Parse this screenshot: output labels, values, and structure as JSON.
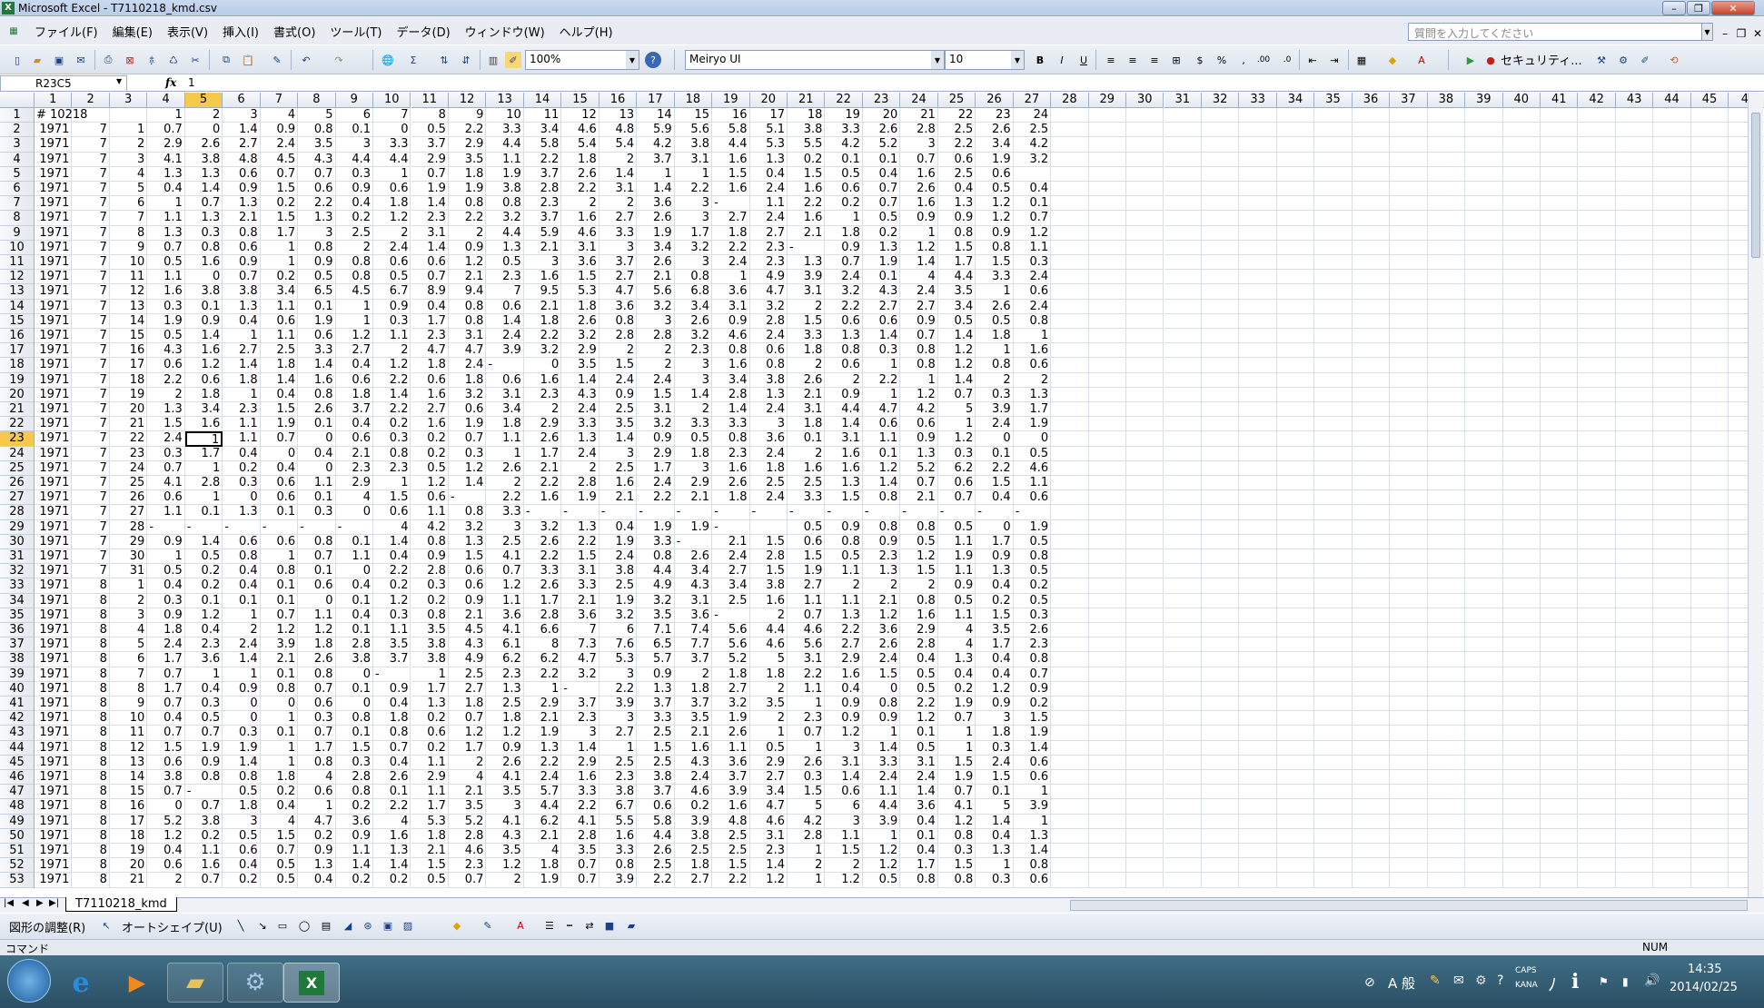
{
  "window": {
    "title": "Microsoft Excel - T7110218_kmd.csv"
  },
  "menu": [
    "ファイル(F)",
    "編集(E)",
    "表示(V)",
    "挿入(I)",
    "書式(O)",
    "ツール(T)",
    "データ(D)",
    "ウィンドウ(W)",
    "ヘルプ(H)"
  ],
  "ask_placeholder": "質問を入力してください",
  "toolbar": {
    "zoom": "100%",
    "font": "Meiryo UI",
    "size": "10",
    "security": "セキュリティ..."
  },
  "formula": {
    "namebox": "R23C5",
    "fx": "fx",
    "value": "1"
  },
  "active": {
    "row": 23,
    "col": 5
  },
  "col_headers": [
    "1",
    "2",
    "3",
    "4",
    "5",
    "6",
    "7",
    "8",
    "9",
    "10",
    "11",
    "12",
    "13",
    "14",
    "15",
    "16",
    "17",
    "18",
    "19",
    "20",
    "21",
    "22",
    "23",
    "24",
    "25",
    "26",
    "27",
    "28",
    "29",
    "30",
    "31",
    "32",
    "33",
    "34",
    "35",
    "36",
    "37",
    "38",
    "39",
    "40",
    "41",
    "42",
    "43",
    "44",
    "45",
    "4("
  ],
  "rows": [
    [
      "# 10218",
      "",
      "",
      "1",
      "2",
      "3",
      "4",
      "5",
      "6",
      "7",
      "8",
      "9",
      "10",
      "11",
      "12",
      "13",
      "14",
      "15",
      "16",
      "17",
      "18",
      "19",
      "20",
      "21",
      "22",
      "23",
      "24"
    ],
    [
      "1971",
      "7",
      "1",
      "0.7",
      "0",
      "1.4",
      "0.9",
      "0.8",
      "0.1",
      "0",
      "0.5",
      "2.2",
      "3.3",
      "3.4",
      "4.6",
      "4.8",
      "5.9",
      "5.6",
      "5.8",
      "5.1",
      "3.8",
      "3.3",
      "2.6",
      "2.8",
      "2.5",
      "2.6",
      "2.5"
    ],
    [
      "1971",
      "7",
      "2",
      "2.9",
      "2.6",
      "2.7",
      "2.4",
      "3.5",
      "3",
      "3.3",
      "3.7",
      "2.9",
      "4.4",
      "5.8",
      "5.4",
      "5.4",
      "4.2",
      "3.8",
      "4.4",
      "5.3",
      "5.5",
      "4.2",
      "5.2",
      "3",
      "2.2",
      "3.4",
      "4.2"
    ],
    [
      "1971",
      "7",
      "3",
      "4.1",
      "3.8",
      "4.8",
      "4.5",
      "4.3",
      "4.4",
      "4.4",
      "2.9",
      "3.5",
      "1.1",
      "2.2",
      "1.8",
      "2",
      "3.7",
      "3.1",
      "1.6",
      "1.3",
      "0.2",
      "0.1",
      "0.1",
      "0.7",
      "0.6",
      "1.9",
      "3.2"
    ],
    [
      "1971",
      "7",
      "4",
      "1.3",
      "1.3",
      "0.6",
      "0.7",
      "0.7",
      "0.3",
      "1",
      "0.7",
      "1.8",
      "1.9",
      "3.7",
      "2.6",
      "1.4",
      "1",
      "1",
      "1.5",
      "0.4",
      "1.5",
      "0.5",
      "0.4",
      "1.6",
      "2.5",
      "0.6",
      ""
    ],
    [
      "1971",
      "7",
      "5",
      "0.4",
      "1.4",
      "0.9",
      "1.5",
      "0.6",
      "0.9",
      "0.6",
      "1.9",
      "1.9",
      "3.8",
      "2.8",
      "2.2",
      "3.1",
      "1.4",
      "2.2",
      "1.6",
      "2.4",
      "1.6",
      "0.6",
      "0.7",
      "2.6",
      "0.4",
      "0.5",
      "0.4"
    ],
    [
      "1971",
      "7",
      "6",
      "1",
      "0.7",
      "1.3",
      "0.2",
      "2.2",
      "0.4",
      "1.8",
      "1.4",
      "0.8",
      "0.8",
      "2.3",
      "2",
      "2",
      "3.6",
      "3",
      "-",
      "1.1",
      "2.2",
      "0.2",
      "0.7",
      "1.6",
      "1.3",
      "1.2",
      "0.1"
    ],
    [
      "1971",
      "7",
      "7",
      "1.1",
      "1.3",
      "2.1",
      "1.5",
      "1.3",
      "0.2",
      "1.2",
      "2.3",
      "2.2",
      "3.2",
      "3.7",
      "1.6",
      "2.7",
      "2.6",
      "3",
      "2.7",
      "2.4",
      "1.6",
      "1",
      "0.5",
      "0.9",
      "0.9",
      "1.2",
      "0.7"
    ],
    [
      "1971",
      "7",
      "8",
      "1.3",
      "0.3",
      "0.8",
      "1.7",
      "3",
      "2.5",
      "2",
      "3.1",
      "2",
      "4.4",
      "5.9",
      "4.6",
      "3.3",
      "1.9",
      "1.7",
      "1.8",
      "2.7",
      "2.1",
      "1.8",
      "0.2",
      "1",
      "0.8",
      "0.9",
      "1.2"
    ],
    [
      "1971",
      "7",
      "9",
      "0.7",
      "0.8",
      "0.6",
      "1",
      "0.8",
      "2",
      "2.4",
      "1.4",
      "0.9",
      "1.3",
      "2.1",
      "3.1",
      "3",
      "3.4",
      "3.2",
      "2.2",
      "2.3",
      "-",
      "0.9",
      "1.3",
      "1.2",
      "1.5",
      "0.8",
      "1.1"
    ],
    [
      "1971",
      "7",
      "10",
      "0.5",
      "1.6",
      "0.9",
      "1",
      "0.9",
      "0.8",
      "0.6",
      "0.6",
      "1.2",
      "0.5",
      "3",
      "3.6",
      "3.7",
      "2.6",
      "3",
      "2.4",
      "2.3",
      "1.3",
      "0.7",
      "1.9",
      "1.4",
      "1.7",
      "1.5",
      "0.3"
    ],
    [
      "1971",
      "7",
      "11",
      "1.1",
      "0",
      "0.7",
      "0.2",
      "0.5",
      "0.8",
      "0.5",
      "0.7",
      "2.1",
      "2.3",
      "1.6",
      "1.5",
      "2.7",
      "2.1",
      "0.8",
      "1",
      "4.9",
      "3.9",
      "2.4",
      "0.1",
      "4",
      "4.4",
      "3.3",
      "2.4"
    ],
    [
      "1971",
      "7",
      "12",
      "1.6",
      "3.8",
      "3.8",
      "3.4",
      "6.5",
      "4.5",
      "6.7",
      "8.9",
      "9.4",
      "7",
      "9.5",
      "5.3",
      "4.7",
      "5.6",
      "6.8",
      "3.6",
      "4.7",
      "3.1",
      "3.2",
      "4.3",
      "2.4",
      "3.5",
      "1",
      "0.6"
    ],
    [
      "1971",
      "7",
      "13",
      "0.3",
      "0.1",
      "1.3",
      "1.1",
      "0.1",
      "1",
      "0.9",
      "0.4",
      "0.8",
      "0.6",
      "2.1",
      "1.8",
      "3.6",
      "3.2",
      "3.4",
      "3.1",
      "3.2",
      "2",
      "2.2",
      "2.7",
      "2.7",
      "3.4",
      "2.6",
      "2.4"
    ],
    [
      "1971",
      "7",
      "14",
      "1.9",
      "0.9",
      "0.4",
      "0.6",
      "1.9",
      "1",
      "0.3",
      "1.7",
      "0.8",
      "1.4",
      "1.8",
      "2.6",
      "0.8",
      "3",
      "2.6",
      "0.9",
      "2.8",
      "1.5",
      "0.6",
      "0.6",
      "0.9",
      "0.5",
      "0.5",
      "0.8"
    ],
    [
      "1971",
      "7",
      "15",
      "0.5",
      "1.4",
      "1",
      "1.1",
      "0.6",
      "1.2",
      "1.1",
      "2.3",
      "3.1",
      "2.4",
      "2.2",
      "3.2",
      "2.8",
      "2.8",
      "3.2",
      "4.6",
      "2.4",
      "3.3",
      "1.3",
      "1.4",
      "0.7",
      "1.4",
      "1.8",
      "1"
    ],
    [
      "1971",
      "7",
      "16",
      "4.3",
      "1.6",
      "2.7",
      "2.5",
      "3.3",
      "2.7",
      "2",
      "4.7",
      "4.7",
      "3.9",
      "3.2",
      "2.9",
      "2",
      "2",
      "2.3",
      "0.8",
      "0.6",
      "1.8",
      "0.8",
      "0.3",
      "0.8",
      "1.2",
      "1",
      "1.6"
    ],
    [
      "1971",
      "7",
      "17",
      "0.6",
      "1.2",
      "1.4",
      "1.8",
      "1.4",
      "0.4",
      "1.2",
      "1.8",
      "2.4",
      "-",
      "0",
      "3.5",
      "1.5",
      "2",
      "3",
      "1.6",
      "0.8",
      "2",
      "0.6",
      "1",
      "0.8",
      "1.2",
      "0.8",
      "0.6"
    ],
    [
      "1971",
      "7",
      "18",
      "2.2",
      "0.6",
      "1.8",
      "1.4",
      "1.6",
      "0.6",
      "2.2",
      "0.6",
      "1.8",
      "0.6",
      "1.6",
      "1.4",
      "2.4",
      "2.4",
      "3",
      "3.4",
      "3.8",
      "2.6",
      "2",
      "2.2",
      "1",
      "1.4",
      "2",
      "2"
    ],
    [
      "1971",
      "7",
      "19",
      "2",
      "1.8",
      "1",
      "0.4",
      "0.8",
      "1.8",
      "1.4",
      "1.6",
      "3.2",
      "3.1",
      "2.3",
      "4.3",
      "0.9",
      "1.5",
      "1.4",
      "2.8",
      "1.3",
      "2.1",
      "0.9",
      "1",
      "1.2",
      "0.7",
      "0.3",
      "1.3"
    ],
    [
      "1971",
      "7",
      "20",
      "1.3",
      "3.4",
      "2.3",
      "1.5",
      "2.6",
      "3.7",
      "2.2",
      "2.7",
      "0.6",
      "3.4",
      "2",
      "2.4",
      "2.5",
      "3.1",
      "2",
      "1.4",
      "2.4",
      "3.1",
      "4.4",
      "4.7",
      "4.2",
      "5",
      "3.9",
      "1.7"
    ],
    [
      "1971",
      "7",
      "21",
      "1.5",
      "1.6",
      "1.1",
      "1.9",
      "0.1",
      "0.4",
      "0.2",
      "1.6",
      "1.9",
      "1.8",
      "2.9",
      "3.3",
      "3.5",
      "3.2",
      "3.3",
      "3.3",
      "3",
      "1.8",
      "1.4",
      "0.6",
      "0.6",
      "1",
      "2.4",
      "1.9"
    ],
    [
      "1971",
      "7",
      "22",
      "2.4",
      "1",
      "1.1",
      "0.7",
      "0",
      "0.6",
      "0.3",
      "0.2",
      "0.7",
      "1.1",
      "2.6",
      "1.3",
      "1.4",
      "0.9",
      "0.5",
      "0.8",
      "3.6",
      "0.1",
      "3.1",
      "1.1",
      "0.9",
      "1.2",
      "0",
      "0"
    ],
    [
      "1971",
      "7",
      "23",
      "0.3",
      "1.7",
      "0.4",
      "0",
      "0.4",
      "2.1",
      "0.8",
      "0.2",
      "0.3",
      "1",
      "1.7",
      "2.4",
      "3",
      "2.9",
      "1.8",
      "2.3",
      "2.4",
      "2",
      "1.6",
      "0.1",
      "1.3",
      "0.3",
      "0.1",
      "0.5"
    ],
    [
      "1971",
      "7",
      "24",
      "0.7",
      "1",
      "0.2",
      "0.4",
      "0",
      "2.3",
      "2.3",
      "0.5",
      "1.2",
      "2.6",
      "2.1",
      "2",
      "2.5",
      "1.7",
      "3",
      "1.6",
      "1.8",
      "1.6",
      "1.6",
      "1.2",
      "5.2",
      "6.2",
      "2.2",
      "4.6"
    ],
    [
      "1971",
      "7",
      "25",
      "4.1",
      "2.8",
      "0.3",
      "0.6",
      "1.1",
      "2.9",
      "1",
      "1.2",
      "1.4",
      "2",
      "2.2",
      "2.8",
      "1.6",
      "2.4",
      "2.9",
      "2.6",
      "2.5",
      "2.5",
      "1.3",
      "1.4",
      "0.7",
      "0.6",
      "1.5",
      "1.1"
    ],
    [
      "1971",
      "7",
      "26",
      "0.6",
      "1",
      "0",
      "0.6",
      "0.1",
      "4",
      "1.5",
      "0.6",
      "-",
      "2.2",
      "1.6",
      "1.9",
      "2.1",
      "2.2",
      "2.1",
      "1.8",
      "2.4",
      "3.3",
      "1.5",
      "0.8",
      "2.1",
      "0.7",
      "0.4",
      "0.6"
    ],
    [
      "1971",
      "7",
      "27",
      "1.1",
      "0.1",
      "1.3",
      "0.1",
      "0.3",
      "0",
      "0.6",
      "1.1",
      "0.8",
      "3.3",
      "-",
      "-",
      "-",
      "-",
      "-",
      "-",
      "-",
      "-",
      "-",
      "-",
      "-",
      "-",
      "-",
      "-"
    ],
    [
      "1971",
      "7",
      "28",
      "-",
      "-",
      "-",
      "-",
      "-",
      "-",
      "4",
      "4.2",
      "3.2",
      "3",
      "3.2",
      "1.3",
      "0.4",
      "1.9",
      "1.9",
      "-",
      "",
      "0.5",
      "0.9",
      "0.8",
      "0.8",
      "0.5",
      "0",
      "1.9"
    ],
    [
      "1971",
      "7",
      "29",
      "0.9",
      "1.4",
      "0.6",
      "0.6",
      "0.8",
      "0.1",
      "1.4",
      "0.8",
      "1.3",
      "2.5",
      "2.6",
      "2.2",
      "1.9",
      "3.3",
      "-",
      "2.1",
      "1.5",
      "0.6",
      "0.8",
      "0.9",
      "0.5",
      "1.1",
      "1.7",
      "0.5"
    ],
    [
      "1971",
      "7",
      "30",
      "1",
      "0.5",
      "0.8",
      "1",
      "0.7",
      "1.1",
      "0.4",
      "0.9",
      "1.5",
      "4.1",
      "2.2",
      "1.5",
      "2.4",
      "0.8",
      "2.6",
      "2.4",
      "2.8",
      "1.5",
      "0.5",
      "2.3",
      "1.2",
      "1.9",
      "0.9",
      "0.8"
    ],
    [
      "1971",
      "7",
      "31",
      "0.5",
      "0.2",
      "0.4",
      "0.8",
      "0.1",
      "0",
      "2.2",
      "2.8",
      "0.6",
      "0.7",
      "3.3",
      "3.1",
      "3.8",
      "4.4",
      "3.4",
      "2.7",
      "1.5",
      "1.9",
      "1.1",
      "1.3",
      "1.5",
      "1.1",
      "1.3",
      "0.5"
    ],
    [
      "1971",
      "8",
      "1",
      "0.4",
      "0.2",
      "0.4",
      "0.1",
      "0.6",
      "0.4",
      "0.2",
      "0.3",
      "0.6",
      "1.2",
      "2.6",
      "3.3",
      "2.5",
      "4.9",
      "4.3",
      "3.4",
      "3.8",
      "2.7",
      "2",
      "2",
      "2",
      "0.9",
      "0.4",
      "0.2"
    ],
    [
      "1971",
      "8",
      "2",
      "0.3",
      "0.1",
      "0.1",
      "0.1",
      "0",
      "0.1",
      "1.2",
      "0.2",
      "0.9",
      "1.1",
      "1.7",
      "2.1",
      "1.9",
      "3.2",
      "3.1",
      "2.5",
      "1.6",
      "1.1",
      "1.1",
      "2.1",
      "0.8",
      "0.5",
      "0.2",
      "0.5"
    ],
    [
      "1971",
      "8",
      "3",
      "0.9",
      "1.2",
      "1",
      "0.7",
      "1.1",
      "0.4",
      "0.3",
      "0.8",
      "2.1",
      "3.6",
      "2.8",
      "3.6",
      "3.2",
      "3.5",
      "3.6",
      "-",
      "2",
      "0.7",
      "1.3",
      "1.2",
      "1.6",
      "1.1",
      "1.5",
      "0.3"
    ],
    [
      "1971",
      "8",
      "4",
      "1.8",
      "0.4",
      "2",
      "1.2",
      "1.2",
      "0.1",
      "1.1",
      "3.5",
      "4.5",
      "4.1",
      "6.6",
      "7",
      "6",
      "7.1",
      "7.4",
      "5.6",
      "4.4",
      "4.6",
      "2.2",
      "3.6",
      "2.9",
      "4",
      "3.5",
      "2.6"
    ],
    [
      "1971",
      "8",
      "5",
      "2.4",
      "2.3",
      "2.4",
      "3.9",
      "1.8",
      "2.8",
      "3.5",
      "3.8",
      "4.3",
      "6.1",
      "8",
      "7.3",
      "7.6",
      "6.5",
      "7.7",
      "5.6",
      "4.6",
      "5.6",
      "2.7",
      "2.6",
      "2.8",
      "4",
      "1.7",
      "2.3"
    ],
    [
      "1971",
      "8",
      "6",
      "1.7",
      "3.6",
      "1.4",
      "2.1",
      "2.6",
      "3.8",
      "3.7",
      "3.8",
      "4.9",
      "6.2",
      "6.2",
      "4.7",
      "5.3",
      "5.7",
      "3.7",
      "5.2",
      "5",
      "3.1",
      "2.9",
      "2.4",
      "0.4",
      "1.3",
      "0.4",
      "0.8"
    ],
    [
      "1971",
      "8",
      "7",
      "0.7",
      "1",
      "1",
      "0.1",
      "0.8",
      "0",
      "-",
      "1",
      "2.5",
      "2.3",
      "2.2",
      "3.2",
      "3",
      "0.9",
      "2",
      "1.8",
      "1.8",
      "2.2",
      "1.6",
      "1.5",
      "0.5",
      "0.4",
      "0.4",
      "0.7"
    ],
    [
      "1971",
      "8",
      "8",
      "1.7",
      "0.4",
      "0.9",
      "0.8",
      "0.7",
      "0.1",
      "0.9",
      "1.7",
      "2.7",
      "1.3",
      "1",
      "-",
      "2.2",
      "1.3",
      "1.8",
      "2.7",
      "2",
      "1.1",
      "0.4",
      "0",
      "0.5",
      "0.2",
      "1.2",
      "0.9"
    ],
    [
      "1971",
      "8",
      "9",
      "0.7",
      "0.3",
      "0",
      "0",
      "0.6",
      "0",
      "0.4",
      "1.3",
      "1.8",
      "2.5",
      "2.9",
      "3.7",
      "3.9",
      "3.7",
      "3.7",
      "3.2",
      "3.5",
      "1",
      "0.9",
      "0.8",
      "2.2",
      "1.9",
      "0.9",
      "0.2"
    ],
    [
      "1971",
      "8",
      "10",
      "0.4",
      "0.5",
      "0",
      "1",
      "0.3",
      "0.8",
      "1.8",
      "0.2",
      "0.7",
      "1.8",
      "2.1",
      "2.3",
      "3",
      "3.3",
      "3.5",
      "1.9",
      "2",
      "2.3",
      "0.9",
      "0.9",
      "1.2",
      "0.7",
      "3",
      "1.5"
    ],
    [
      "1971",
      "8",
      "11",
      "0.7",
      "0.7",
      "0.3",
      "0.1",
      "0.7",
      "0.1",
      "0.8",
      "0.6",
      "1.2",
      "1.2",
      "1.9",
      "3",
      "2.7",
      "2.5",
      "2.1",
      "2.6",
      "1",
      "0.7",
      "1.2",
      "1",
      "0.1",
      "1",
      "1.8",
      "1.9"
    ],
    [
      "1971",
      "8",
      "12",
      "1.5",
      "1.9",
      "1.9",
      "1",
      "1.7",
      "1.5",
      "0.7",
      "0.2",
      "1.7",
      "0.9",
      "1.3",
      "1.4",
      "1",
      "1.5",
      "1.6",
      "1.1",
      "0.5",
      "1",
      "3",
      "1.4",
      "0.5",
      "1",
      "0.3",
      "1.4"
    ],
    [
      "1971",
      "8",
      "13",
      "0.6",
      "0.9",
      "1.4",
      "1",
      "0.8",
      "0.3",
      "0.4",
      "1.1",
      "2",
      "2.6",
      "2.2",
      "2.9",
      "2.5",
      "2.5",
      "4.3",
      "3.6",
      "2.9",
      "2.6",
      "3.1",
      "3.3",
      "3.1",
      "1.5",
      "2.4",
      "0.6"
    ],
    [
      "1971",
      "8",
      "14",
      "3.8",
      "0.8",
      "0.8",
      "1.8",
      "4",
      "2.8",
      "2.6",
      "2.9",
      "4",
      "4.1",
      "2.4",
      "1.6",
      "2.3",
      "3.8",
      "2.4",
      "3.7",
      "2.7",
      "0.3",
      "1.4",
      "2.4",
      "2.4",
      "1.9",
      "1.5",
      "0.6"
    ],
    [
      "1971",
      "8",
      "15",
      "0.7",
      "-",
      "0.5",
      "0.2",
      "0.6",
      "0.8",
      "0.1",
      "1.1",
      "2.1",
      "3.5",
      "5.7",
      "3.3",
      "3.8",
      "3.7",
      "4.6",
      "3.9",
      "3.4",
      "1.5",
      "0.6",
      "1.1",
      "1.4",
      "0.7",
      "0.1",
      "1"
    ],
    [
      "1971",
      "8",
      "16",
      "0",
      "0.7",
      "1.8",
      "0.4",
      "1",
      "0.2",
      "2.2",
      "1.7",
      "3.5",
      "3",
      "4.4",
      "2.2",
      "6.7",
      "0.6",
      "0.2",
      "1.6",
      "4.7",
      "5",
      "6",
      "4.4",
      "3.6",
      "4.1",
      "5",
      "3.9"
    ],
    [
      "1971",
      "8",
      "17",
      "5.2",
      "3.8",
      "3",
      "4",
      "4.7",
      "3.6",
      "4",
      "5.3",
      "5.2",
      "4.1",
      "6.2",
      "4.1",
      "5.5",
      "5.8",
      "3.9",
      "4.8",
      "4.6",
      "4.2",
      "3",
      "3.9",
      "0.4",
      "1.2",
      "1.4",
      "1"
    ],
    [
      "1971",
      "8",
      "18",
      "1.2",
      "0.2",
      "0.5",
      "1.5",
      "0.2",
      "0.9",
      "1.6",
      "1.8",
      "2.8",
      "4.3",
      "2.1",
      "2.8",
      "1.6",
      "4.4",
      "3.8",
      "2.5",
      "3.1",
      "2.8",
      "1.1",
      "1",
      "0.1",
      "0.8",
      "0.4",
      "1.3"
    ],
    [
      "1971",
      "8",
      "19",
      "0.4",
      "1.1",
      "0.6",
      "0.7",
      "0.9",
      "1.1",
      "1.3",
      "2.1",
      "4.6",
      "3.5",
      "4",
      "3.5",
      "3.3",
      "2.6",
      "2.5",
      "2.5",
      "2.3",
      "1",
      "1.5",
      "1.2",
      "0.4",
      "0.3",
      "1.3",
      "1.4"
    ],
    [
      "1971",
      "8",
      "20",
      "0.6",
      "1.6",
      "0.4",
      "0.5",
      "1.3",
      "1.4",
      "1.4",
      "1.5",
      "2.3",
      "1.2",
      "1.8",
      "0.7",
      "0.8",
      "2.5",
      "1.8",
      "1.5",
      "1.4",
      "2",
      "2",
      "1.2",
      "1.7",
      "1.5",
      "1",
      "0.8"
    ],
    [
      "1971",
      "8",
      "21",
      "2",
      "0.7",
      "0.2",
      "0.5",
      "0.4",
      "0.2",
      "0.2",
      "0.5",
      "0.7",
      "2",
      "1.9",
      "0.7",
      "3.9",
      "2.2",
      "2.7",
      "2.2",
      "1.2",
      "1",
      "1.2",
      "0.5",
      "0.8",
      "0.8",
      "0.3",
      "0.6"
    ]
  ],
  "sheet_tab": "T7110218_kmd",
  "draw_toolbar": {
    "adjust": "図形の調整(R)",
    "autoshape": "オートシェイプ(U)"
  },
  "status": {
    "left": "コマンド",
    "num": "NUM"
  },
  "taskbar": {
    "time": "14:35",
    "date": "2014/02/25",
    "ime": "A 般",
    "caps": "CAPS",
    "kana": "KANA"
  }
}
